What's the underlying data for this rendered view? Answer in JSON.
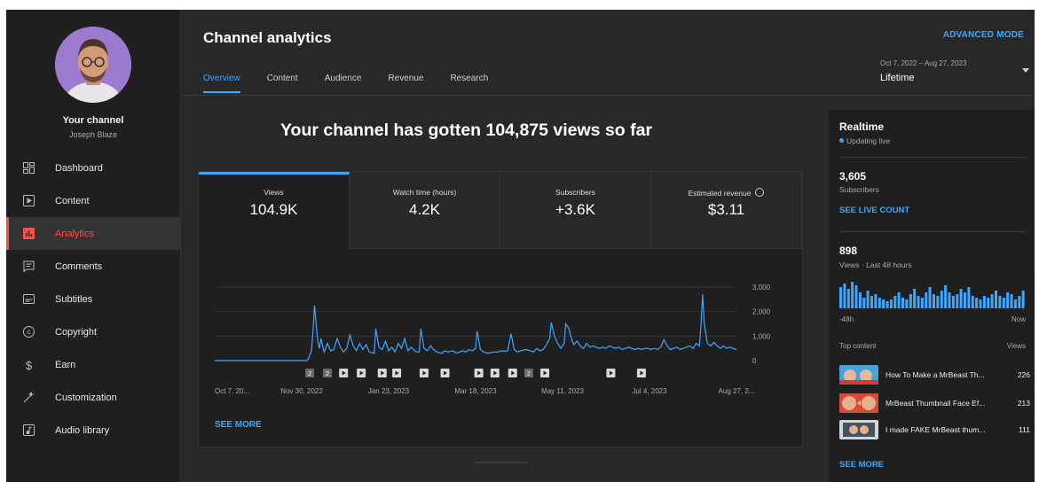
{
  "sidebar": {
    "channel_title": "Your channel",
    "channel_name": "Joseph Blaze",
    "items": [
      {
        "label": "Dashboard",
        "icon": "dashboard-icon"
      },
      {
        "label": "Content",
        "icon": "content-icon"
      },
      {
        "label": "Analytics",
        "icon": "analytics-icon",
        "active": true
      },
      {
        "label": "Comments",
        "icon": "comments-icon"
      },
      {
        "label": "Subtitles",
        "icon": "subtitles-icon"
      },
      {
        "label": "Copyright",
        "icon": "copyright-icon"
      },
      {
        "label": "Earn",
        "icon": "earn-icon"
      },
      {
        "label": "Customization",
        "icon": "customization-icon"
      },
      {
        "label": "Audio library",
        "icon": "audio-library-icon"
      }
    ]
  },
  "header": {
    "title": "Channel analytics",
    "advanced_mode": "ADVANCED MODE",
    "tabs": [
      "Overview",
      "Content",
      "Audience",
      "Revenue",
      "Research"
    ],
    "date_range": "Oct 7, 2022 – Aug 27, 2023",
    "date_period": "Lifetime"
  },
  "main": {
    "headline": "Your channel has gotten 104,875 views so far",
    "metrics": [
      {
        "label": "Views",
        "value": "104.9K"
      },
      {
        "label": "Watch time (hours)",
        "value": "4.2K"
      },
      {
        "label": "Subscribers",
        "value": "+3.6K"
      },
      {
        "label": "Estimated revenue",
        "value": "$3.11"
      }
    ],
    "see_more": "SEE MORE"
  },
  "chart_data": {
    "type": "line",
    "x_tick_labels": [
      "Oct 7, 20...",
      "Nov 30, 2022",
      "Jan 23, 2023",
      "Mar 18, 2023",
      "May 11, 2023",
      "Jul 4, 2023",
      "Aug 27, 2..."
    ],
    "y_tick_labels": [
      "3,000",
      "2,000",
      "1,000",
      "0"
    ],
    "ylim": [
      0,
      3000
    ],
    "n_days": 325,
    "series": [
      {
        "values": [
          [
            0,
            0
          ],
          [
            57,
            0
          ],
          [
            58,
            50
          ],
          [
            60,
            380
          ],
          [
            61,
            1150
          ],
          [
            62,
            2250
          ],
          [
            63,
            1500
          ],
          [
            64,
            800
          ],
          [
            65,
            500
          ],
          [
            66,
            900
          ],
          [
            67,
            600
          ],
          [
            68,
            350
          ],
          [
            70,
            700
          ],
          [
            72,
            400
          ],
          [
            74,
            450
          ],
          [
            76,
            900
          ],
          [
            78,
            550
          ],
          [
            80,
            350
          ],
          [
            82,
            500
          ],
          [
            84,
            1050
          ],
          [
            86,
            600
          ],
          [
            88,
            400
          ],
          [
            90,
            700
          ],
          [
            92,
            450
          ],
          [
            94,
            650
          ],
          [
            96,
            350
          ],
          [
            99,
            300
          ],
          [
            100,
            1300
          ],
          [
            102,
            550
          ],
          [
            104,
            450
          ],
          [
            106,
            800
          ],
          [
            108,
            400
          ],
          [
            110,
            550
          ],
          [
            112,
            350
          ],
          [
            114,
            700
          ],
          [
            116,
            500
          ],
          [
            118,
            900
          ],
          [
            120,
            400
          ],
          [
            122,
            550
          ],
          [
            125,
            350
          ],
          [
            127,
            350
          ],
          [
            128,
            1300
          ],
          [
            130,
            500
          ],
          [
            132,
            400
          ],
          [
            134,
            600
          ],
          [
            136,
            450
          ],
          [
            138,
            350
          ],
          [
            141,
            300
          ],
          [
            143,
            400
          ],
          [
            145,
            350
          ],
          [
            148,
            400
          ],
          [
            150,
            300
          ],
          [
            152,
            350
          ],
          [
            154,
            400
          ],
          [
            156,
            350
          ],
          [
            158,
            450
          ],
          [
            160,
            400
          ],
          [
            162,
            500
          ],
          [
            163,
            1200
          ],
          [
            165,
            450
          ],
          [
            167,
            350
          ],
          [
            170,
            300
          ],
          [
            173,
            350
          ],
          [
            176,
            350
          ],
          [
            178,
            400
          ],
          [
            180,
            380
          ],
          [
            182,
            400
          ],
          [
            184,
            1100
          ],
          [
            186,
            450
          ],
          [
            188,
            350
          ],
          [
            190,
            400
          ],
          [
            193,
            450
          ],
          [
            196,
            400
          ],
          [
            198,
            350
          ],
          [
            200,
            500
          ],
          [
            202,
            400
          ],
          [
            204,
            450
          ],
          [
            206,
            650
          ],
          [
            208,
            900
          ],
          [
            209,
            1550
          ],
          [
            211,
            1000
          ],
          [
            213,
            700
          ],
          [
            215,
            500
          ],
          [
            217,
            700
          ],
          [
            218,
            1500
          ],
          [
            220,
            1300
          ],
          [
            221,
            1000
          ],
          [
            223,
            650
          ],
          [
            225,
            800
          ],
          [
            227,
            600
          ],
          [
            229,
            500
          ],
          [
            231,
            700
          ],
          [
            233,
            550
          ],
          [
            235,
            600
          ],
          [
            237,
            550
          ],
          [
            239,
            500
          ],
          [
            241,
            550
          ],
          [
            243,
            500
          ],
          [
            245,
            600
          ],
          [
            247,
            550
          ],
          [
            249,
            500
          ],
          [
            251,
            550
          ],
          [
            253,
            450
          ],
          [
            255,
            500
          ],
          [
            257,
            550
          ],
          [
            259,
            500
          ],
          [
            261,
            450
          ],
          [
            263,
            500
          ],
          [
            265,
            450
          ],
          [
            267,
            500
          ],
          [
            269,
            500
          ],
          [
            271,
            450
          ],
          [
            273,
            500
          ],
          [
            275,
            450
          ],
          [
            277,
            550
          ],
          [
            279,
            850
          ],
          [
            281,
            600
          ],
          [
            283,
            450
          ],
          [
            285,
            500
          ],
          [
            287,
            550
          ],
          [
            289,
            450
          ],
          [
            291,
            500
          ],
          [
            293,
            550
          ],
          [
            295,
            600
          ],
          [
            297,
            500
          ],
          [
            299,
            700
          ],
          [
            301,
            600
          ],
          [
            302,
            1500
          ],
          [
            303,
            2700
          ],
          [
            304,
            1500
          ],
          [
            306,
            700
          ],
          [
            308,
            600
          ],
          [
            310,
            750
          ],
          [
            312,
            600
          ],
          [
            314,
            500
          ],
          [
            316,
            600
          ],
          [
            318,
            500
          ],
          [
            320,
            550
          ],
          [
            322,
            500
          ],
          [
            324,
            450
          ]
        ]
      }
    ],
    "markers": [
      {
        "day": 59,
        "type": "numbered",
        "label": "2"
      },
      {
        "day": 70,
        "type": "numbered",
        "label": "2"
      },
      {
        "day": 80,
        "type": "play"
      },
      {
        "day": 91,
        "type": "play"
      },
      {
        "day": 104,
        "type": "play"
      },
      {
        "day": 113,
        "type": "play"
      },
      {
        "day": 130,
        "type": "play"
      },
      {
        "day": 143,
        "type": "play"
      },
      {
        "day": 164,
        "type": "play"
      },
      {
        "day": 174,
        "type": "play"
      },
      {
        "day": 185,
        "type": "play"
      },
      {
        "day": 195,
        "type": "numbered",
        "label": "2"
      },
      {
        "day": 205,
        "type": "play"
      },
      {
        "day": 246,
        "type": "play"
      },
      {
        "day": 265,
        "type": "play"
      }
    ]
  },
  "realtime": {
    "title": "Realtime",
    "status": "Updating live",
    "subscribers": "3,605",
    "subscribers_label": "Subscribers",
    "see_live_count": "SEE LIVE COUNT",
    "views": "898",
    "views_label": "Views · Last 48 hours",
    "axis_left": "-48h",
    "axis_right": "Now",
    "hourly_views": [
      24,
      28,
      22,
      30,
      26,
      18,
      12,
      20,
      14,
      16,
      12,
      10,
      8,
      10,
      14,
      18,
      12,
      10,
      16,
      22,
      14,
      12,
      18,
      24,
      16,
      14,
      20,
      26,
      18,
      14,
      16,
      22,
      18,
      24,
      14,
      12,
      10,
      14,
      12,
      16,
      20,
      14,
      12,
      18,
      16,
      10,
      14,
      20
    ],
    "top_content_label": "Top content",
    "views_col_label": "Views",
    "top_content": [
      {
        "title": "How To Make a MrBeast Th...",
        "views": "226"
      },
      {
        "title": "MrBeast Thumbnail Face Ef...",
        "views": "213"
      },
      {
        "title": "I made FAKE MrBeast thum...",
        "views": "111"
      }
    ],
    "see_more": "SEE MORE"
  },
  "colors": {
    "accent": "#3ea6ff",
    "active_nav": "#ff4e45",
    "line": "#3ea6ff"
  }
}
